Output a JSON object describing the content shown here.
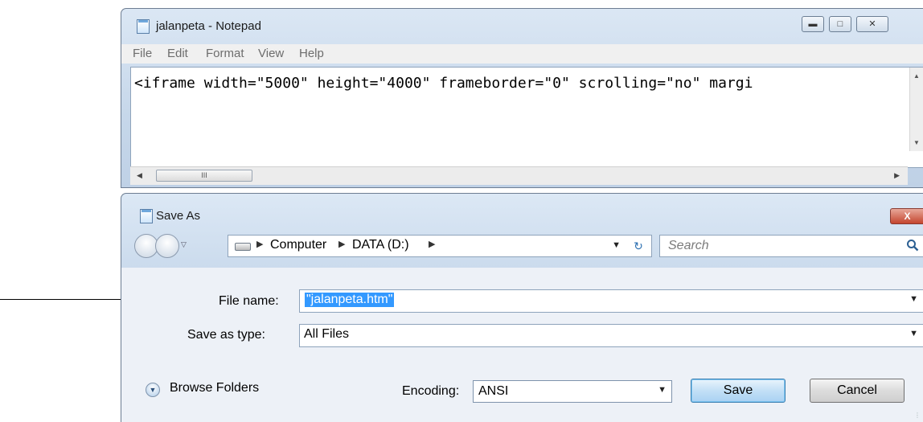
{
  "notepad": {
    "title": "jalanpeta - Notepad",
    "menu": [
      "File",
      "Edit",
      "Format",
      "View",
      "Help"
    ],
    "content": "<iframe width=\"5000\" height=\"4000\" frameborder=\"0\" scrolling=\"no\" margi",
    "scroll_thumb_glyph": "III"
  },
  "dialog": {
    "title": "Save As",
    "close_glyph": "X",
    "breadcrumb": [
      "Computer",
      "DATA (D:)"
    ],
    "search_placeholder": "Search",
    "file_name_label": "File name:",
    "file_name_value": "\"jalanpeta.htm\"",
    "save_type_label": "Save as type:",
    "save_type_value": "All Files",
    "browse_folders_label": "Browse Folders",
    "encoding_label": "Encoding:",
    "encoding_value": "ANSI",
    "save_label": "Save",
    "cancel_label": "Cancel"
  },
  "icons": [
    "notepad-icon",
    "minimize-icon",
    "maximize-icon",
    "close-icon",
    "back-icon",
    "forward-icon",
    "drive-icon",
    "refresh-icon",
    "search-icon",
    "expand-icon",
    "dropdown-arrow-icon"
  ],
  "colors": {
    "selection": "#3399ff",
    "titlebar": "#c7d8eb",
    "close_button": "#c4452e"
  }
}
